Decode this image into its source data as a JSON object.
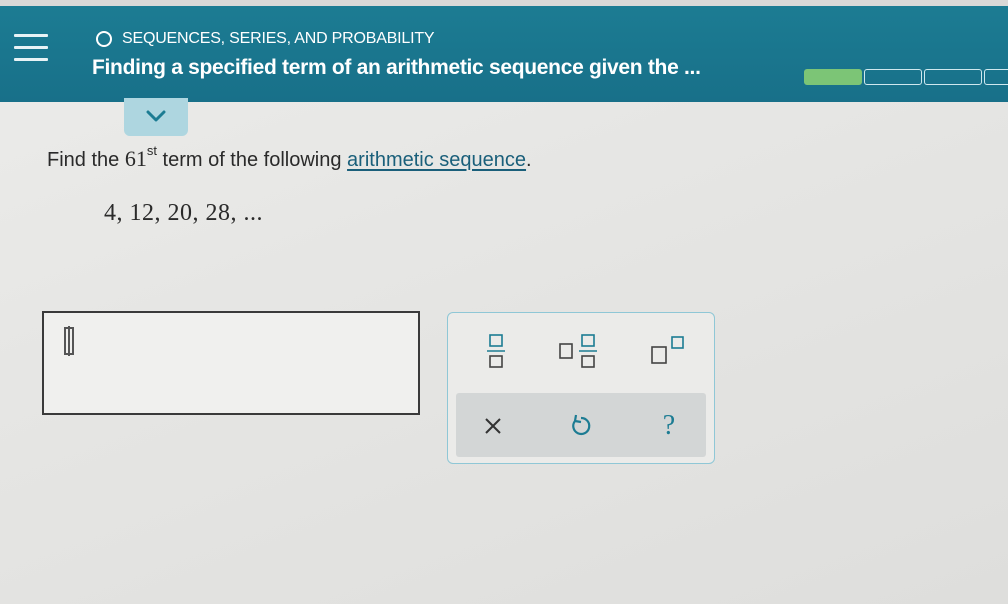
{
  "header": {
    "topic": "SEQUENCES, SERIES, AND PROBABILITY",
    "title": "Finding a specified term of an arithmetic sequence given the ...",
    "progress": {
      "segments_total": 4,
      "segments_filled": 1
    }
  },
  "question": {
    "prefix": "Find the ",
    "term_number": "61",
    "term_suffix": "st",
    "middle": " term of the following ",
    "link_text": "arithmetic sequence",
    "end": "."
  },
  "sequence": {
    "text": "4,  12,  20,  28,   ..."
  },
  "answer": {
    "value": ""
  },
  "keypad": {
    "keys": [
      "fraction-icon",
      "mixed-number-icon",
      "superscript-icon"
    ],
    "actions": [
      "clear-icon",
      "undo-icon",
      "help-icon"
    ],
    "help_label": "?"
  },
  "colors": {
    "header": "#1c7c93",
    "progress_filled": "#7cc576",
    "link": "#1a5f7a",
    "tab": "#aed6e0"
  }
}
